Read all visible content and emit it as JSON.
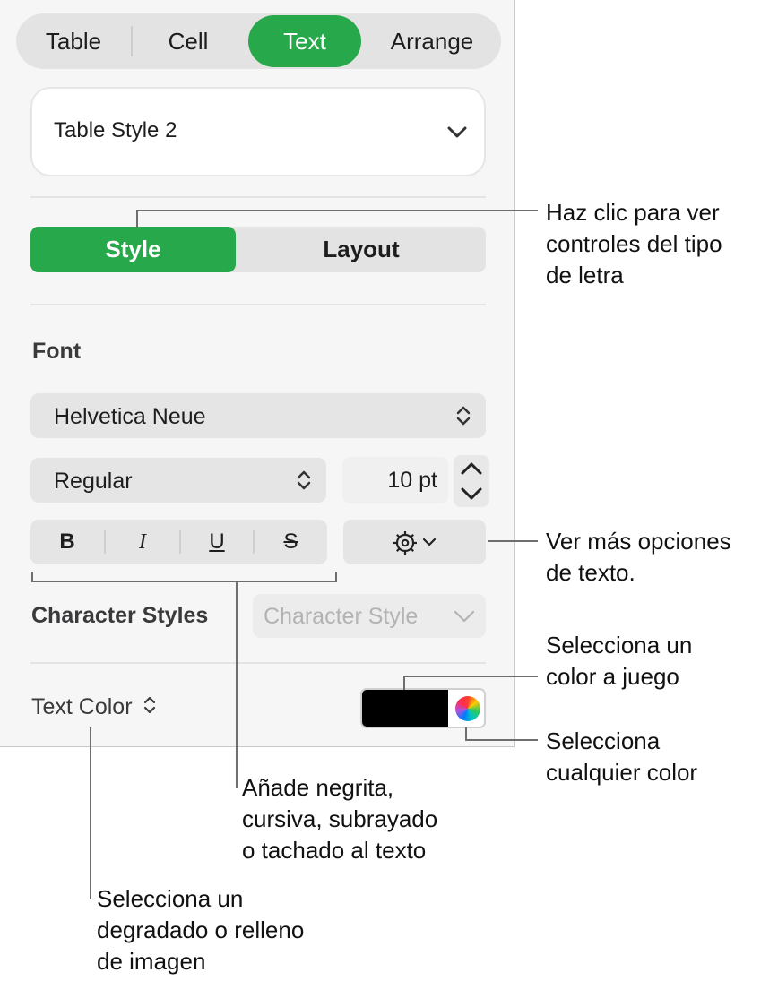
{
  "tabs": [
    "Table",
    "Cell",
    "Text",
    "Arrange"
  ],
  "active_tab": "Text",
  "table_style": {
    "value": "Table Style 2"
  },
  "segments": {
    "style": "Style",
    "layout": "Layout"
  },
  "font": {
    "section_title": "Font",
    "family": "Helvetica Neue",
    "typeface": "Regular",
    "size": "10 pt"
  },
  "format_buttons": {
    "bold": "B",
    "italic": "I",
    "underline": "U",
    "strikethrough": "S"
  },
  "character_styles": {
    "label": "Character Styles",
    "placeholder": "Character Style"
  },
  "text_color": {
    "label": "Text Color",
    "swatch": "#000000"
  },
  "colors": {
    "accent": "#27a84a"
  },
  "callouts": {
    "style_tab": [
      "Haz clic para ver",
      "controles del tipo",
      "de letra"
    ],
    "more_options": [
      "Ver más opciones",
      "de texto."
    ],
    "matching_color": [
      "Selecciona un",
      "color a juego"
    ],
    "any_color": [
      "Selecciona",
      "cualquier color"
    ],
    "bold_italic": [
      "Añade negrita,",
      "cursiva, subrayado",
      "o tachado al texto"
    ],
    "gradient_fill": [
      "Selecciona un",
      "degradado o relleno",
      "de imagen"
    ]
  }
}
